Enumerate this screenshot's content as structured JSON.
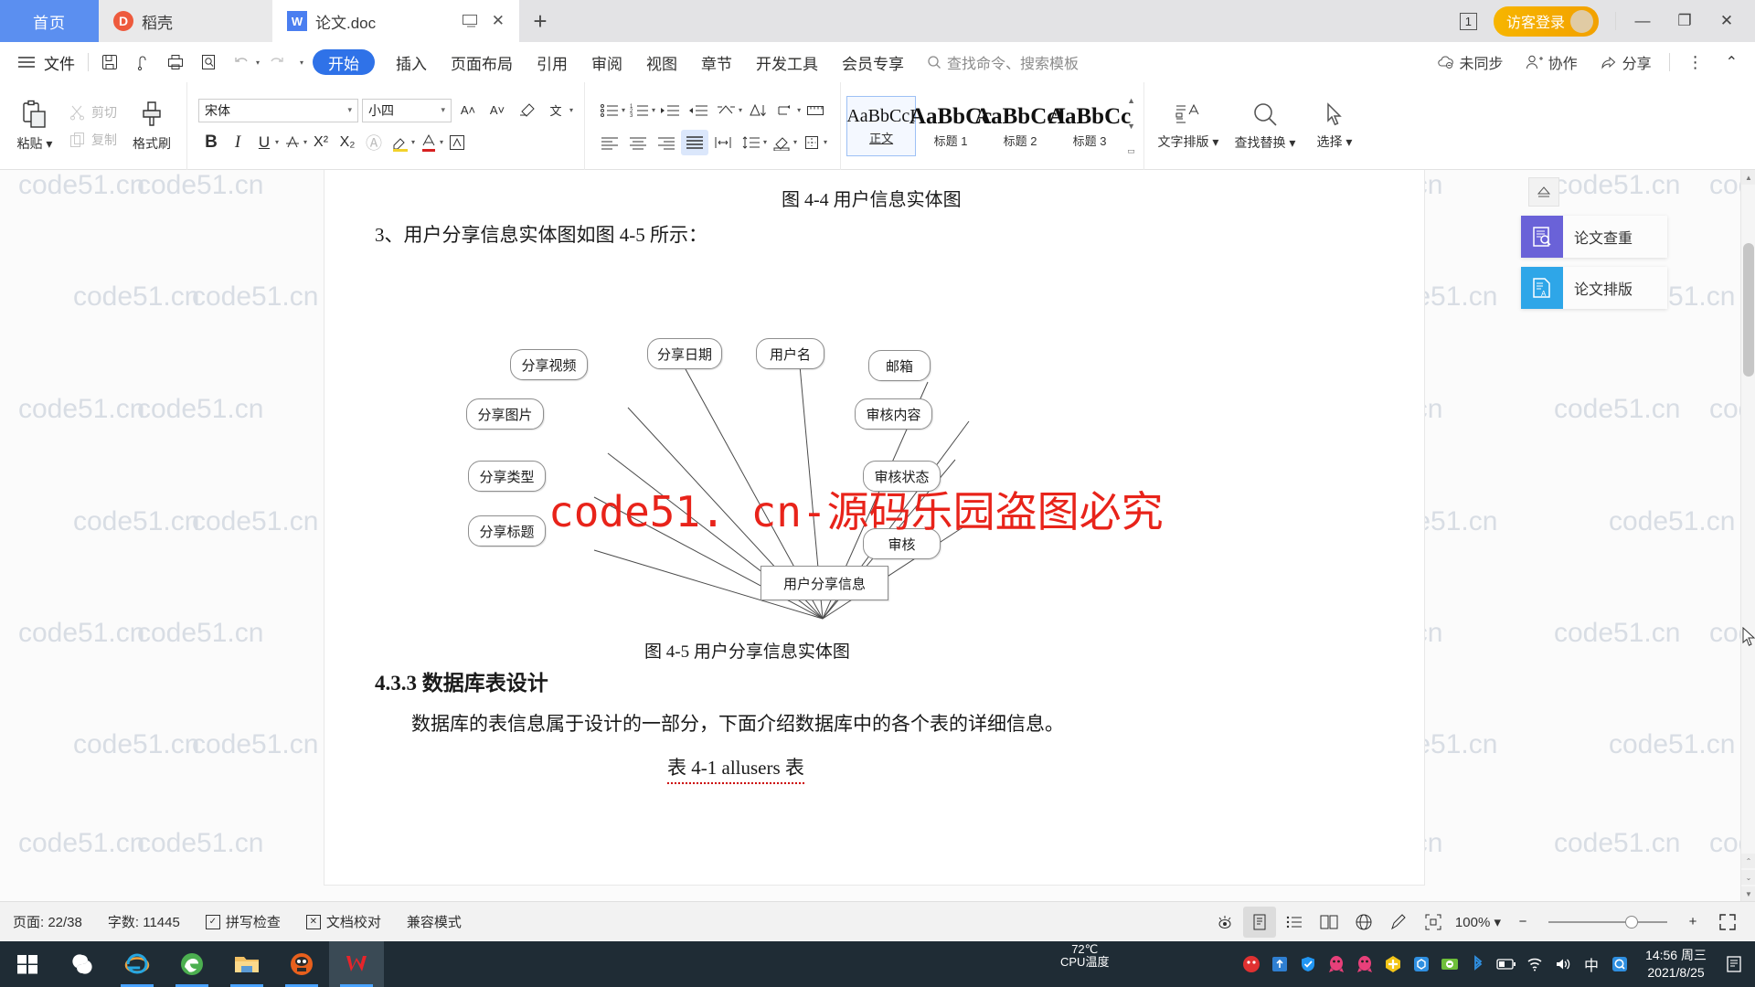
{
  "titlebar": {
    "home_tab": "首页",
    "tabs": [
      {
        "label": "稻壳",
        "icon": "daoke-icon",
        "active": false
      },
      {
        "label": "论文.doc",
        "icon": "wps-writer-icon",
        "active": true
      }
    ],
    "new_tab": "+",
    "doc_count": "1",
    "login_label": "访客登录",
    "minimize": "—",
    "maximize": "❐",
    "close": "✕"
  },
  "ribbon_tabs": {
    "menu_label": "文件",
    "quick_access": [
      "save-icon",
      "autosave-icon",
      "print-icon",
      "print-preview-icon",
      "undo-icon",
      "undo-dropdown-icon",
      "redo-icon",
      "qat-dropdown-icon"
    ],
    "items": [
      "开始",
      "插入",
      "页面布局",
      "引用",
      "审阅",
      "视图",
      "章节",
      "开发工具",
      "会员专享"
    ],
    "selected": "开始",
    "search_placeholder": "查找命令、搜索模板",
    "sync_label": "未同步",
    "collab_label": "协作",
    "share_label": "分享"
  },
  "ribbon": {
    "clipboard": {
      "paste": "粘贴",
      "cut": "剪切",
      "copy": "复制",
      "format_painter": "格式刷"
    },
    "font": {
      "family": "宋体",
      "size": "小四",
      "bold": "B",
      "italic": "I",
      "underline": "U",
      "superscript": "X²",
      "subscript": "X₂"
    },
    "styles": [
      {
        "preview": "AaBbCcI",
        "name": "正文",
        "selected": true,
        "big": false
      },
      {
        "preview": "AaBbCc",
        "name": "标题 1",
        "selected": false,
        "big": true
      },
      {
        "preview": "AaBbCcI",
        "name": "标题 2",
        "selected": false,
        "big": true
      },
      {
        "preview": "AaBbCc",
        "name": "标题 3",
        "selected": false,
        "big": true
      }
    ],
    "tools": [
      {
        "label": "文字排版",
        "icon": "text-layout-icon"
      },
      {
        "label": "查找替换",
        "icon": "find-replace-icon"
      },
      {
        "label": "选择",
        "icon": "select-pointer-icon"
      }
    ]
  },
  "document": {
    "caption_4_4": "图 4-4 用户信息实体图",
    "paragraph_intro": "3、用户分享信息实体图如图 4-5 所示：",
    "caption_4_5": "图 4-5 用户分享信息实体图",
    "heading_433": "4.3.3  数据库表设计",
    "body_433": "数据库的表信息属于设计的一部分，下面介绍数据库中的各个表的详细信息。",
    "table_caption": "表 4-1 allusers 表",
    "watermark_tile": "code51.cn",
    "watermark_red": "code51. cn-源码乐园盗图必究"
  },
  "er_diagram": {
    "center": "用户分享信息",
    "attributes": [
      "分享视频",
      "分享日期",
      "用户名",
      "邮箱",
      "分享图片",
      "审核内容",
      "审核状态",
      "分享类型",
      "分享标题",
      "审核"
    ]
  },
  "right_panel": {
    "eject_icon": "eject-icon",
    "buttons": [
      {
        "label": "论文查重",
        "icon": "paper-check-icon",
        "color": "#6a62d8"
      },
      {
        "label": "论文排版",
        "icon": "paper-format-icon",
        "color": "#2ea6e8"
      }
    ]
  },
  "statusbar": {
    "page": "页面: 22/38",
    "words": "字数: 11445",
    "spellcheck": "拼写检查",
    "proofread": "文档校对",
    "compat": "兼容模式",
    "views": [
      "eye-icon",
      "print-layout-icon",
      "outline-icon",
      "reading-icon",
      "web-layout-icon",
      "ink-icon"
    ],
    "fit_icon": "fit-page-icon",
    "zoom": "100%",
    "zoom_out": "−",
    "zoom_in": "+",
    "fullscreen": "fullscreen-icon"
  },
  "taskbar": {
    "start": "start-icon",
    "apps": [
      "sogou-icon",
      "internet-explorer-icon",
      "edge-legacy-icon",
      "file-explorer-icon",
      "tim-icon",
      "wps-writer-icon"
    ],
    "cpu_temp_value": "72℃",
    "cpu_temp_label": "CPU温度",
    "tray": [
      "360-icon",
      "security-upload-icon",
      "shield-icon",
      "qq-icon",
      "qq2-icon",
      "plus-green-icon",
      "blue-gear-icon",
      "green-sync-icon",
      "bluetooth-icon",
      "battery-icon",
      "wifi-icon",
      "volume-icon",
      "ime-chinese-icon",
      "q-search-icon"
    ],
    "clock_time": "14:56 周三",
    "clock_date": "2021/8/25",
    "notifications": "notification-icon"
  }
}
